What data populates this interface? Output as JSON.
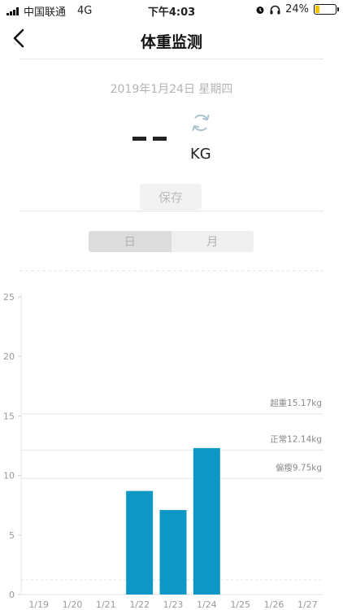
{
  "status_bar": {
    "carrier": "中国联通",
    "network": "4G",
    "time": "下午4:03",
    "battery_percent": "24%",
    "battery_level": 0.24
  },
  "header": {
    "title": "体重监测"
  },
  "record": {
    "date": "2019年1月24日 星期四",
    "unit": "KG",
    "save_label": "保存"
  },
  "tabs": [
    {
      "label": "日",
      "active": true
    },
    {
      "label": "月",
      "active": false
    }
  ],
  "colors": {
    "bar": "#0d97c4",
    "accent_text": "#888888"
  },
  "chart_data": {
    "type": "bar",
    "categories": [
      "1/19",
      "1/20",
      "1/21",
      "1/22",
      "1/23",
      "1/24",
      "1/25",
      "1/26",
      "1/27"
    ],
    "values": [
      null,
      null,
      null,
      8.7,
      7.1,
      12.3,
      null,
      null,
      null
    ],
    "ylim": [
      0,
      25
    ],
    "yticks": [
      0,
      5,
      10,
      15,
      20,
      25
    ],
    "reference_lines": [
      {
        "label": "超重15.17kg",
        "value": 15.17
      },
      {
        "label": "正常12.14kg",
        "value": 12.14
      },
      {
        "label": "偏瘦9.75kg",
        "value": 9.75
      }
    ]
  }
}
